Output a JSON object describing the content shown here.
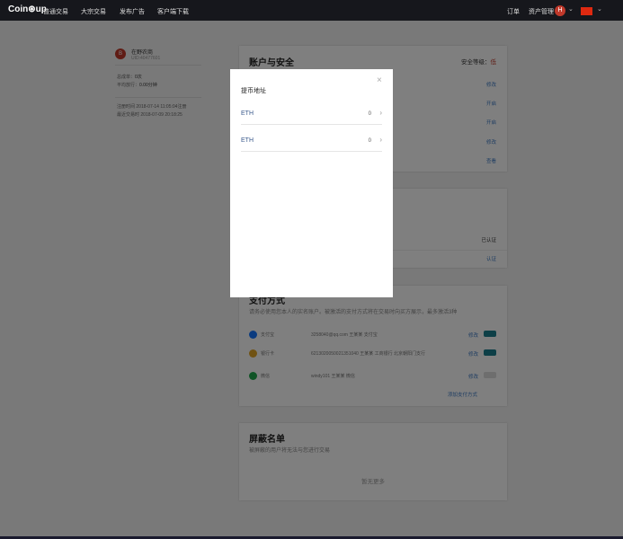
{
  "topbar": {
    "logo": "Coin⊛up",
    "nav": [
      "普通交易",
      "大宗交易",
      "发布广告",
      "客户端下载"
    ],
    "orders": "订单",
    "assets": "资产管理",
    "avatar_letter": "H",
    "chevron": "⌄"
  },
  "profile": {
    "avatar_letter": "B",
    "name": "在野农商",
    "uid": "UID:40477601",
    "trades_label": "总成单：",
    "trades_value": "0次",
    "avg_time_label": "平均放行：",
    "avg_time_value": "0.00分钟",
    "register": "注册时间 2018-07-14 11:05:04注册",
    "last_trade": "最近交易时 2018-07-09 20:18:25"
  },
  "security_card": {
    "title": "账户与安全",
    "level_label": "安全等级：",
    "level_value": "低",
    "links": [
      "修改",
      "开启",
      "开启",
      "修改",
      "查看"
    ]
  },
  "verify_card": {
    "status": "已认证",
    "link": "认证"
  },
  "payment_card": {
    "title": "支付方式",
    "desc": "请务必使用您本人的实名账户。被激活的支付方式将在交易时向买方展示，最多激活3种",
    "rows": [
      {
        "name": "支付宝",
        "account": "3258040@qq.com 王某某 支付宝",
        "action": "修改",
        "icon": "alipay-icon",
        "color": "#1677ff",
        "on": true
      },
      {
        "name": "银行卡",
        "account": "6213020050021351040 王某某 工商银行 北京朝阳门支行",
        "action": "修改",
        "icon": "bank-icon",
        "color": "#e0a526",
        "on": true
      },
      {
        "name": "微信",
        "account": "windy101 王某某 微信",
        "action": "修改",
        "icon": "wechat-icon",
        "color": "#20a84c",
        "on": false
      }
    ],
    "add": "添加支付方式"
  },
  "block_card": {
    "title": "屏蔽名单",
    "desc": "被屏蔽的用户将无法与您进行交易",
    "empty": "暂无更多"
  },
  "modal": {
    "title": "提币地址",
    "close": "×",
    "rows": [
      {
        "coin": "ETH",
        "count": "0",
        "arrow": "›"
      },
      {
        "coin": "ETH",
        "count": "0",
        "arrow": "›"
      }
    ]
  },
  "colors": {
    "accent": "#3a78c3",
    "topbar": "#16171c",
    "danger": "#c0392b"
  }
}
